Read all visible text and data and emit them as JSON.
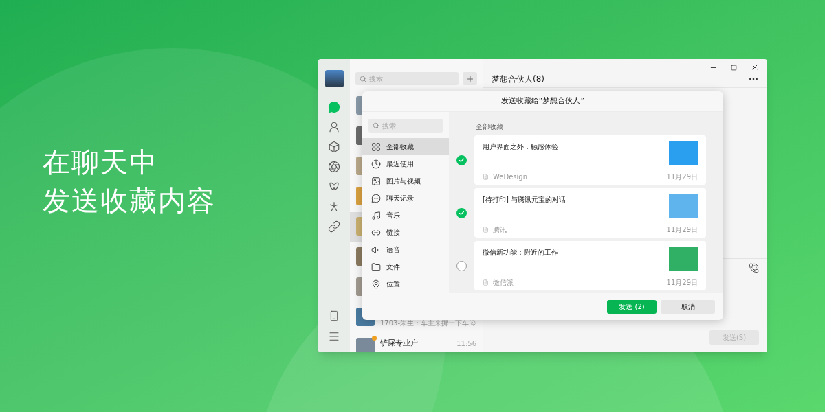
{
  "headline": [
    "在聊天中",
    "发送收藏内容"
  ],
  "nav": [
    {
      "selected": true
    },
    {
      "selected": false
    },
    {
      "selected": false
    },
    {
      "selected": false
    },
    {
      "selected": false
    },
    {
      "selected": false
    },
    {
      "selected": false
    }
  ],
  "search": {
    "placeholder": "搜索"
  },
  "chats": [
    {
      "selected": false
    },
    {
      "selected": false
    },
    {
      "selected": false
    },
    {
      "selected": false
    },
    {
      "selected": true
    },
    {
      "selected": false
    },
    {
      "selected": false
    },
    {
      "selected": false,
      "preview": "1703-朱生：车主来挪一下车",
      "muted": true
    },
    {
      "selected": false,
      "name": "铲屎专业户",
      "time": "11:56",
      "unread": true
    }
  ],
  "chat": {
    "title": "梦想合伙人(8)",
    "send_button": "发送(S)"
  },
  "dialog": {
    "title": "发送收藏给“梦想合伙人”",
    "search_placeholder": "搜索",
    "section_title": "全部收藏",
    "categories": [
      {
        "label": "全部收藏",
        "selected": true
      },
      {
        "label": "最近使用",
        "selected": false
      },
      {
        "label": "图片与视频",
        "selected": false
      },
      {
        "label": "聊天记录",
        "selected": false
      },
      {
        "label": "音乐",
        "selected": false
      },
      {
        "label": "链接",
        "selected": false
      },
      {
        "label": "语音",
        "selected": false
      },
      {
        "label": "文件",
        "selected": false
      },
      {
        "label": "位置",
        "selected": false
      }
    ],
    "items": [
      {
        "title": "用户界面之外：触感体验",
        "source": "WeDesign",
        "date": "11月29日",
        "checked": true,
        "color": "#2a9ff0"
      },
      {
        "title": "[待打印] 与腾讯元宝的对话",
        "source": "腾讯",
        "date": "11月29日",
        "checked": true,
        "color": "#5fb4ee"
      },
      {
        "title": "微信新功能：附近的工作",
        "source": "微信派",
        "date": "11月29日",
        "checked": false,
        "color": "#2fb064"
      }
    ],
    "send_button": "发送 (2)",
    "cancel_button": "取消"
  }
}
